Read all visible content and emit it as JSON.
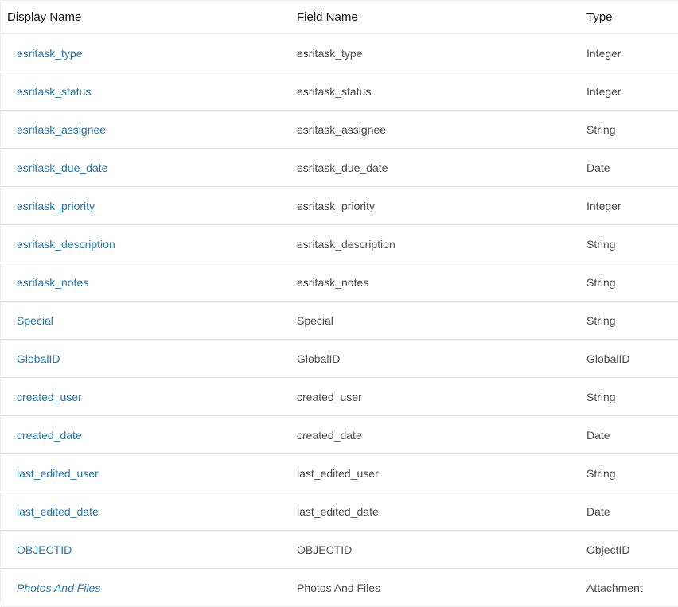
{
  "table": {
    "headers": {
      "display_name": "Display Name",
      "field_name": "Field Name",
      "type": "Type"
    },
    "rows": [
      {
        "display_name": "esritask_type",
        "field_name": "esritask_type",
        "type": "Integer"
      },
      {
        "display_name": "esritask_status",
        "field_name": "esritask_status",
        "type": "Integer"
      },
      {
        "display_name": "esritask_assignee",
        "field_name": "esritask_assignee",
        "type": "String"
      },
      {
        "display_name": "esritask_due_date",
        "field_name": "esritask_due_date",
        "type": "Date"
      },
      {
        "display_name": "esritask_priority",
        "field_name": "esritask_priority",
        "type": "Integer"
      },
      {
        "display_name": "esritask_description",
        "field_name": "esritask_description",
        "type": "String"
      },
      {
        "display_name": "esritask_notes",
        "field_name": "esritask_notes",
        "type": "String"
      },
      {
        "display_name": "Special",
        "field_name": "Special",
        "type": "String"
      },
      {
        "display_name": "GlobalID",
        "field_name": "GlobalID",
        "type": "GlobalID"
      },
      {
        "display_name": "created_user",
        "field_name": "created_user",
        "type": "String"
      },
      {
        "display_name": "created_date",
        "field_name": "created_date",
        "type": "Date"
      },
      {
        "display_name": "last_edited_user",
        "field_name": "last_edited_user",
        "type": "String"
      },
      {
        "display_name": "last_edited_date",
        "field_name": "last_edited_date",
        "type": "Date"
      },
      {
        "display_name": "OBJECTID",
        "field_name": "OBJECTID",
        "type": "ObjectID"
      },
      {
        "display_name": "Photos And Files",
        "field_name": "Photos And Files",
        "type": "Attachment"
      }
    ]
  },
  "colors": {
    "link": "#1a79b0",
    "text": "#4c4c4c",
    "header_text": "#151515",
    "divider": "#e8e8e8"
  }
}
